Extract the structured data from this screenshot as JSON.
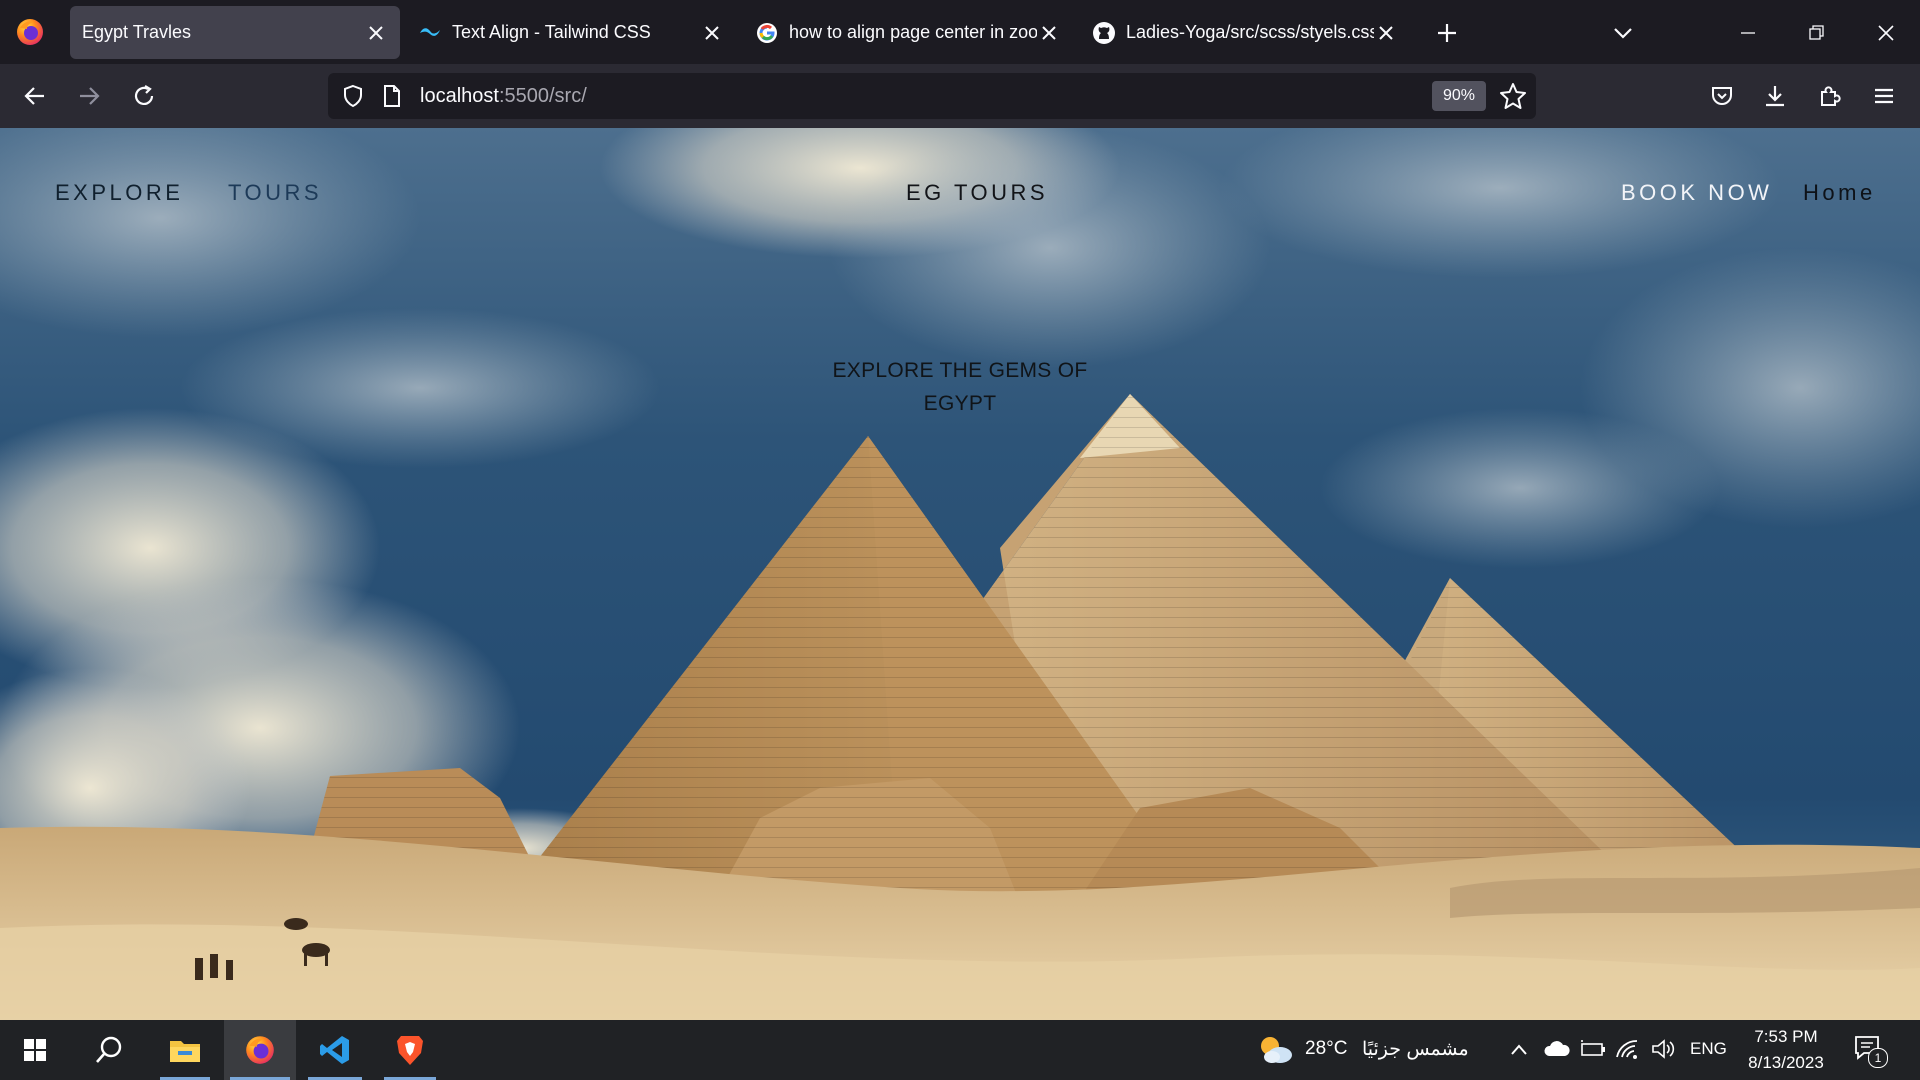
{
  "browser": {
    "tabs": [
      {
        "title": "Egypt Travles",
        "active": true,
        "favicon": "firefox-page-icon"
      },
      {
        "title": "Text Align - Tailwind CSS",
        "active": false,
        "favicon": "tailwind-icon"
      },
      {
        "title": "how to align page center in zoo",
        "active": false,
        "favicon": "google-icon"
      },
      {
        "title": "Ladies-Yoga/src/scss/styels.css",
        "active": false,
        "favicon": "github-icon"
      }
    ],
    "url_host": "localhost",
    "url_path": ":5500/src/",
    "zoom": "90%"
  },
  "site": {
    "nav": {
      "explore": "EXPLORE",
      "tours": "TOURS",
      "brand": "EG TOURS",
      "book_now": "BOOK NOW",
      "home": "Home"
    },
    "hero_line1": "EXPLORE THE GEMS OF",
    "hero_line2": "EGYPT"
  },
  "taskbar": {
    "weather_temp": "28°C",
    "weather_desc": "مشمس جزئيًا",
    "language": "ENG",
    "time": "7:53 PM",
    "date": "8/13/2023",
    "notification_count": "1"
  },
  "colors": {
    "tab_active": "#42414d",
    "toolbar": "#2b2a33",
    "sky": "#2d5478",
    "sand": "#d8b98a"
  }
}
